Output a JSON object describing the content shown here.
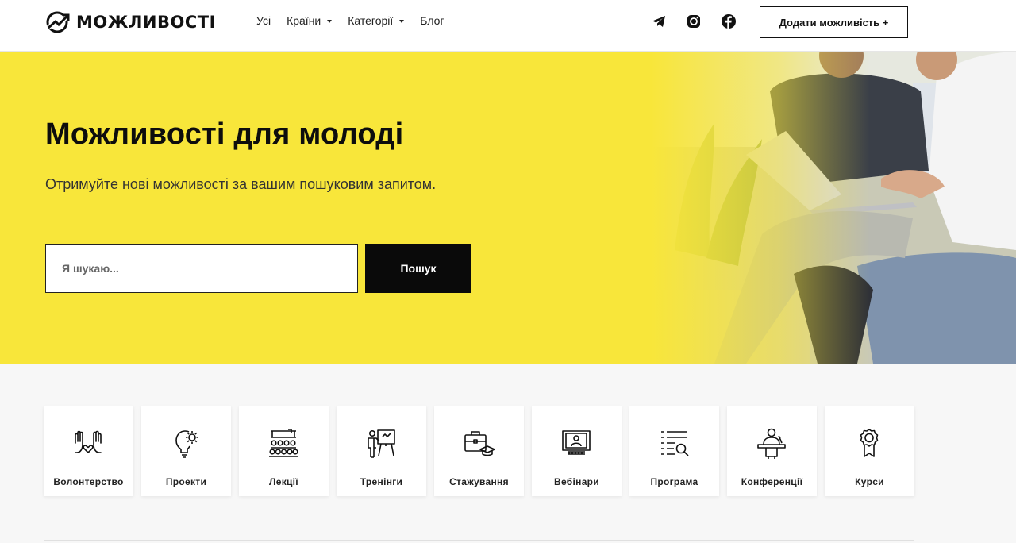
{
  "logo": {
    "text": "МОЖЛИВОСТІ",
    "icon": "logo-arrow-mark"
  },
  "nav": [
    {
      "label": "Усі",
      "dropdown": false
    },
    {
      "label": "Країни",
      "dropdown": true
    },
    {
      "label": "Категорії",
      "dropdown": true
    },
    {
      "label": "Блог",
      "dropdown": false
    }
  ],
  "socials": [
    "telegram-icon",
    "instagram-icon",
    "facebook-icon"
  ],
  "add_button": "Додати можливість +",
  "hero": {
    "title": "Можливості для молоді",
    "subtitle": "Отримуйте нові можливості за вашим пошуковим запитом.",
    "search_placeholder": "Я шукаю...",
    "search_button": "Пошук"
  },
  "categories": [
    {
      "label": "Волонтерство",
      "icon": "hands-heart-icon"
    },
    {
      "label": "Проекти",
      "icon": "lightbulb-gear-icon"
    },
    {
      "label": "Лекції",
      "icon": "lecture-audience-icon"
    },
    {
      "label": "Тренінги",
      "icon": "trainer-board-icon"
    },
    {
      "label": "Стажування",
      "icon": "briefcase-graduation-icon"
    },
    {
      "label": "Вебінари",
      "icon": "monitor-webinar-icon"
    },
    {
      "label": "Програма",
      "icon": "list-search-icon"
    },
    {
      "label": "Конференції",
      "icon": "speaker-podium-icon"
    },
    {
      "label": "Курси",
      "icon": "award-badge-icon"
    }
  ],
  "colors": {
    "accent": "#f8e63a",
    "dark": "#0a0a0a"
  }
}
